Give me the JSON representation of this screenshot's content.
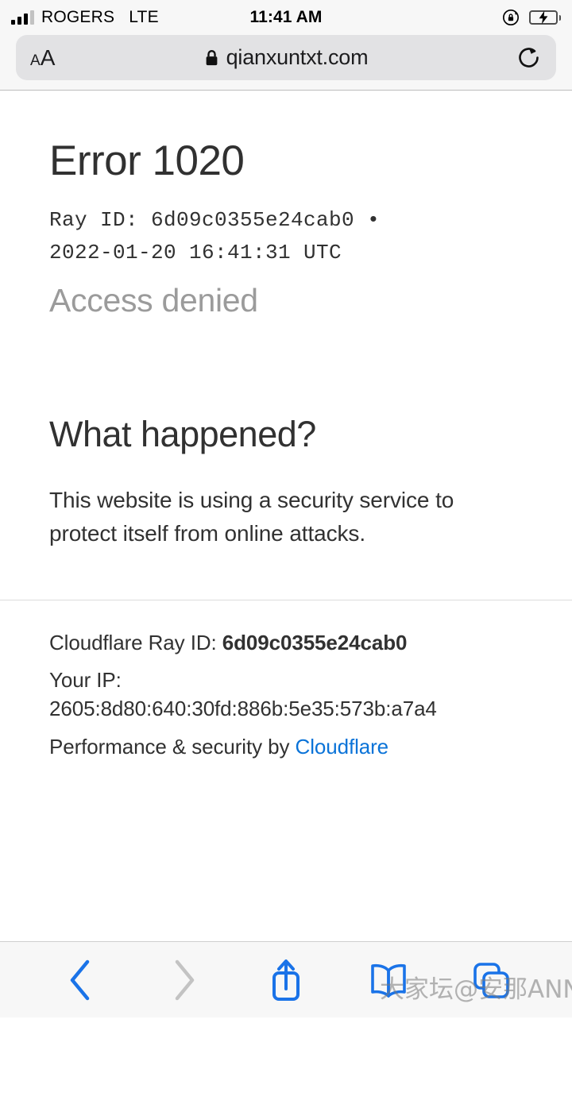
{
  "status_bar": {
    "carrier": "ROGERS",
    "network": "LTE",
    "time": "11:41 AM",
    "signal_bars_filled": 3,
    "signal_bars_total": 4,
    "battery_percent": 52,
    "battery_charging": true,
    "rotation_lock": true,
    "icons": {
      "signal": "signal-bars-icon",
      "rotation_lock": "rotation-lock-icon",
      "battery": "battery-charging-icon"
    }
  },
  "browser": {
    "text_size_label_small": "A",
    "text_size_label_large": "A",
    "url": "qianxuntxt.com",
    "secure": true,
    "icons": {
      "lock": "lock-icon",
      "reload": "reload-icon",
      "text_size": "text-size-icon"
    }
  },
  "page": {
    "error_title": "Error 1020",
    "ray_id_line_1": "Ray ID: 6d09c0355e24cab0 •",
    "ray_id_line_2": "2022-01-20 16:41:31 UTC",
    "access_denied": "Access denied",
    "what_happened_heading": "What happened?",
    "what_happened_body": "This website is using a security service to protect itself from online attacks."
  },
  "footer": {
    "ray_id_label": "Cloudflare Ray ID: ",
    "ray_id_value": "6d09c0355e24cab0",
    "ip_label": "Your IP:",
    "ip_value": "2605:8d80:640:30fd:886b:5e35:573b:a7a4",
    "performance_prefix": "Performance & security by ",
    "performance_link": "Cloudflare",
    "link_color": "#0a73d8"
  },
  "toolbar": {
    "back_label": "Back",
    "forward_label": "Forward",
    "share_label": "Share",
    "bookmarks_label": "Bookmarks",
    "tabs_label": "Tabs",
    "back_enabled": true,
    "forward_enabled": false,
    "accent_color": "#1a73e8",
    "disabled_color": "#c3c3c3",
    "icons": {
      "back": "chevron-left-icon",
      "forward": "chevron-right-icon",
      "share": "share-icon",
      "bookmarks": "book-icon",
      "tabs": "tabs-icon"
    }
  },
  "watermark": {
    "text": "大家坛@安那ANNA"
  }
}
